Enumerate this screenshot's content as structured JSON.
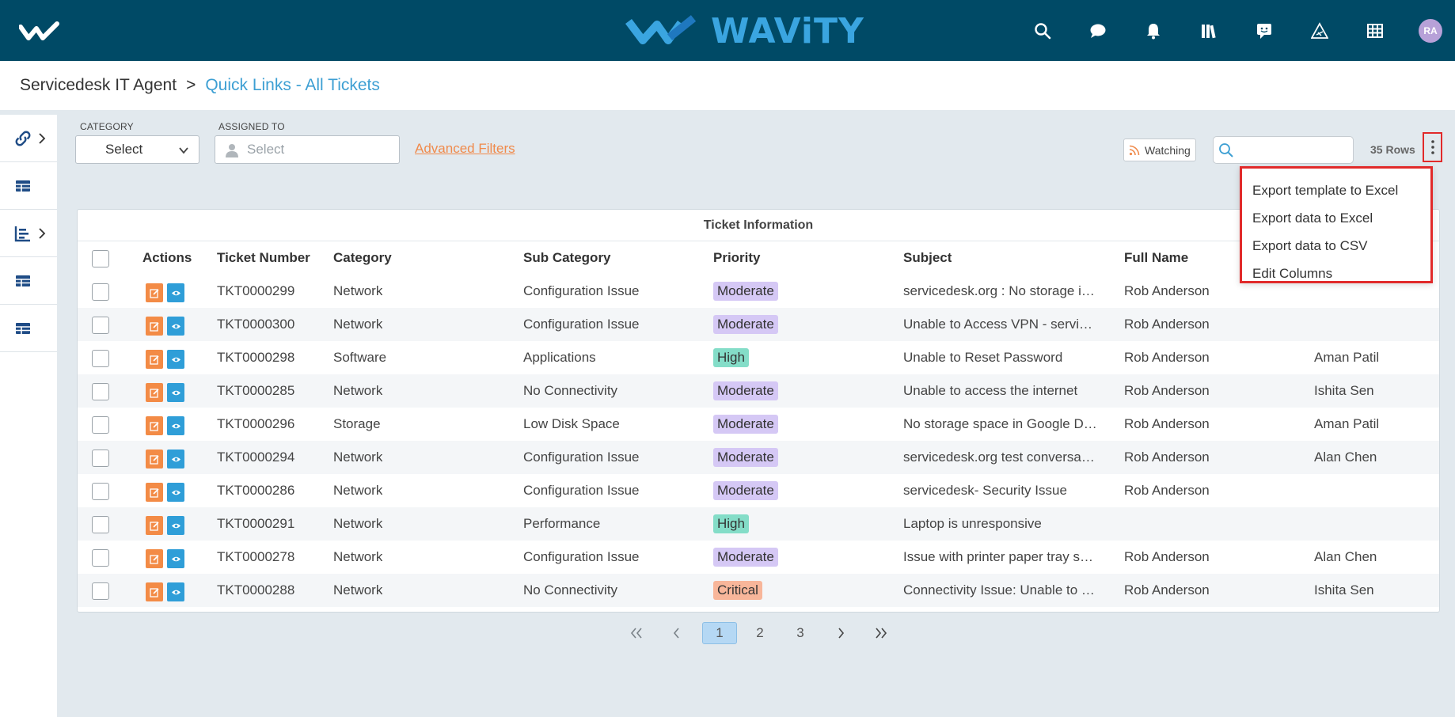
{
  "app": {
    "brand_name": "WAViTY",
    "colors": {
      "header": "#004a66",
      "accent": "#3d9fd3",
      "link_orange": "#f08a4b"
    },
    "header_icons": [
      "search-icon",
      "chat-icon",
      "bell-icon",
      "library-icon",
      "feedback-icon",
      "warning-icon",
      "grid-icon"
    ],
    "avatar_initials": "RA"
  },
  "breadcrumb": {
    "root": "Servicedesk IT Agent",
    "separator": ">",
    "current": "Quick Links - All Tickets"
  },
  "sidebar_icons": [
    "link-icon",
    "table-icon",
    "chart-icon",
    "table-icon",
    "table-icon"
  ],
  "filters": {
    "category_label": "CATEGORY",
    "category_value": "Select",
    "assigned_label": "ASSIGNED TO",
    "assigned_placeholder": "Select",
    "advanced_filters": "Advanced Filters"
  },
  "toolbar": {
    "watching_label": "Watching",
    "search_value": "",
    "rows_count": "35 Rows"
  },
  "context_menu": {
    "items": [
      "Export template to Excel",
      "Export data to Excel",
      "Export data to CSV",
      "Edit Columns"
    ]
  },
  "table": {
    "group_header": "Ticket Information",
    "columns": [
      "Actions",
      "Ticket Number",
      "Category",
      "Sub Category",
      "Priority",
      "Subject",
      "Full Name"
    ],
    "rows": [
      {
        "ticket": "TKT0000299",
        "category": "Network",
        "sub_category": "Configuration Issue",
        "priority": "Moderate",
        "subject": "servicedesk.org : No storage in …",
        "full_name": "Rob Anderson",
        "assignee": ""
      },
      {
        "ticket": "TKT0000300",
        "category": "Network",
        "sub_category": "Configuration Issue",
        "priority": "Moderate",
        "subject": "Unable to Access VPN - service…",
        "full_name": "Rob Anderson",
        "assignee": ""
      },
      {
        "ticket": "TKT0000298",
        "category": "Software",
        "sub_category": "Applications",
        "priority": "High",
        "subject": "Unable to Reset Password",
        "full_name": "Rob Anderson",
        "assignee": "Aman Patil"
      },
      {
        "ticket": "TKT0000285",
        "category": "Network",
        "sub_category": "No Connectivity",
        "priority": "Moderate",
        "subject": "Unable to access the internet",
        "full_name": "Rob Anderson",
        "assignee": "Ishita Sen"
      },
      {
        "ticket": "TKT0000296",
        "category": "Storage",
        "sub_category": "Low Disk Space",
        "priority": "Moderate",
        "subject": "No storage space in Google Dri…",
        "full_name": "Rob Anderson",
        "assignee": "Aman Patil"
      },
      {
        "ticket": "TKT0000294",
        "category": "Network",
        "sub_category": "Configuration Issue",
        "priority": "Moderate",
        "subject": "servicedesk.org test conversati…",
        "full_name": "Rob Anderson",
        "assignee": "Alan Chen"
      },
      {
        "ticket": "TKT0000286",
        "category": "Network",
        "sub_category": "Configuration Issue",
        "priority": "Moderate",
        "subject": "servicedesk- Security Issue",
        "full_name": "Rob Anderson",
        "assignee": ""
      },
      {
        "ticket": "TKT0000291",
        "category": "Network",
        "sub_category": "Performance",
        "priority": "High",
        "subject": "Laptop is unresponsive",
        "full_name": "",
        "assignee": ""
      },
      {
        "ticket": "TKT0000278",
        "category": "Network",
        "sub_category": "Configuration Issue",
        "priority": "Moderate",
        "subject": "Issue with printer paper tray se…",
        "full_name": "Rob Anderson",
        "assignee": "Alan Chen"
      },
      {
        "ticket": "TKT0000288",
        "category": "Network",
        "sub_category": "No Connectivity",
        "priority": "Critical",
        "subject": "Connectivity Issue: Unable to …",
        "full_name": "Rob Anderson",
        "assignee": "Ishita Sen"
      }
    ]
  },
  "pagination": {
    "pages": [
      "1",
      "2",
      "3"
    ],
    "current": "1"
  }
}
